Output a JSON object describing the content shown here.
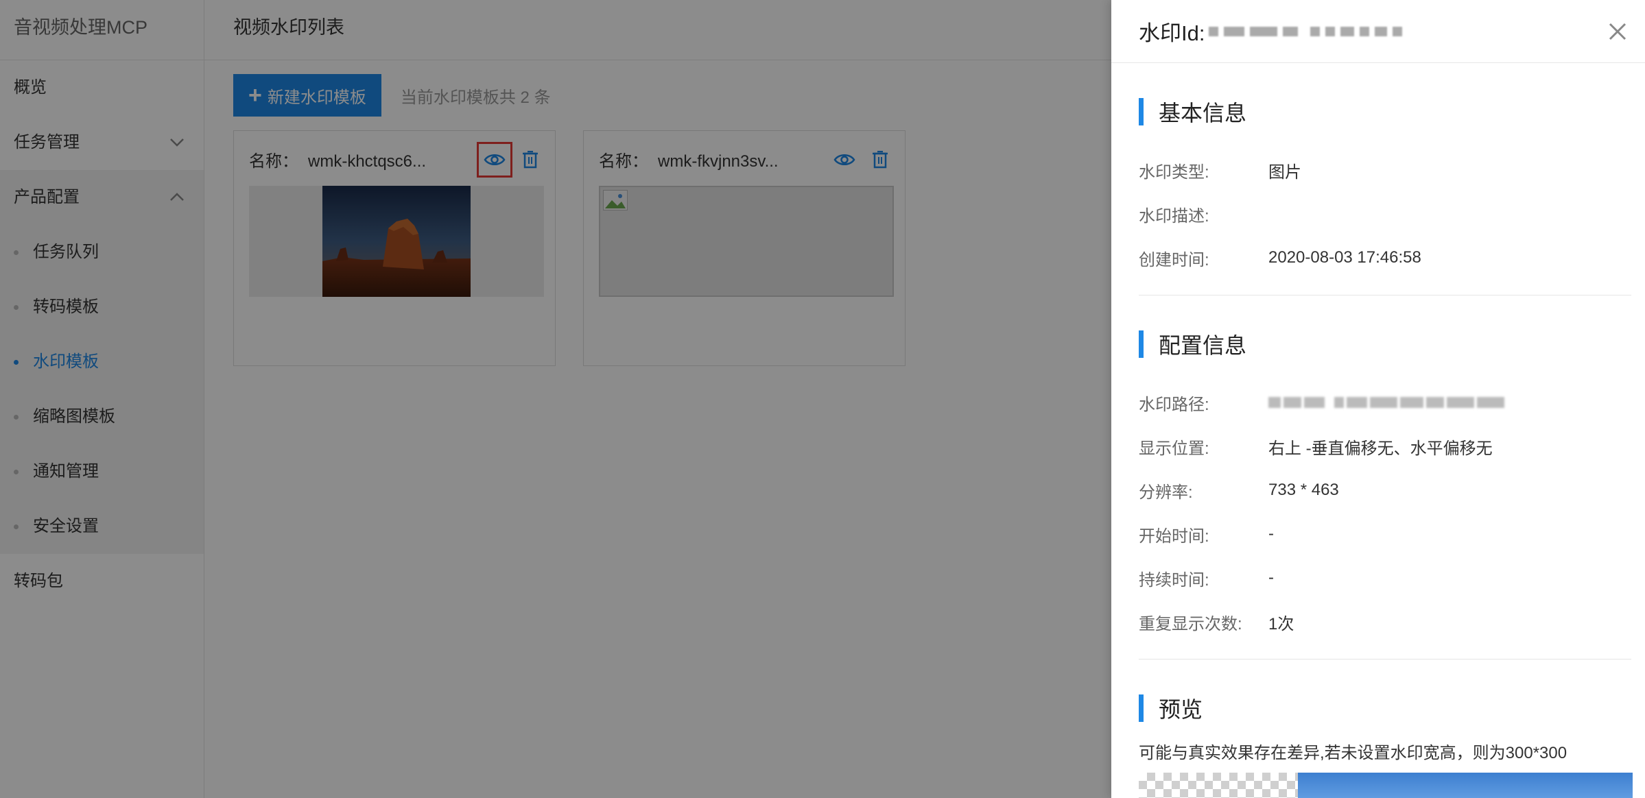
{
  "sidebar": {
    "app_title": "音视频处理MCP",
    "items": [
      {
        "label": "概览"
      },
      {
        "label": "任务管理",
        "chevron": "chevron-down-icon"
      },
      {
        "label": "产品配置",
        "chevron": "chevron-up-icon"
      },
      {
        "label": "转码包"
      }
    ],
    "sub_items": [
      {
        "label": "任务队列"
      },
      {
        "label": "转码模板"
      },
      {
        "label": "水印模板",
        "active": true
      },
      {
        "label": "缩略图模板"
      },
      {
        "label": "通知管理"
      },
      {
        "label": "安全设置"
      }
    ]
  },
  "main": {
    "page_title": "视频水印列表",
    "new_button_label": "新建水印模板",
    "count_text": "当前水印模板共 2 条",
    "cards": [
      {
        "name_label": "名称：",
        "name": "wmk-khctqsc6...",
        "preview_icon": "eye-icon",
        "delete_icon": "trash-icon"
      },
      {
        "name_label": "名称：",
        "name": "wmk-fkvjnn3sv...",
        "preview_icon": "eye-icon",
        "delete_icon": "trash-icon"
      }
    ]
  },
  "drawer": {
    "title_prefix": "水印Id:",
    "basic": {
      "title": "基本信息",
      "type_label": "水印类型:",
      "type_value": "图片",
      "desc_label": "水印描述:",
      "desc_value": "",
      "created_label": "创建时间:",
      "created_value": "2020-08-03 17:46:58"
    },
    "config": {
      "title": "配置信息",
      "path_label": "水印路径:",
      "position_label": "显示位置:",
      "position_value": "右上 -垂直偏移无、水平偏移无",
      "resolution_label": "分辨率:",
      "resolution_value": "733 * 463",
      "start_label": "开始时间:",
      "start_value": "-",
      "duration_label": "持续时间:",
      "duration_value": "-",
      "repeat_label": "重复显示次数:",
      "repeat_value": "1次"
    },
    "preview": {
      "title": "预览",
      "note": "可能与真实效果存在差异,若未设置水印宽高，则为300*300"
    }
  },
  "colors": {
    "accent": "#1e88e5",
    "highlight_border": "#e53935",
    "mask": "rgba(0,0,0,0.45)"
  }
}
